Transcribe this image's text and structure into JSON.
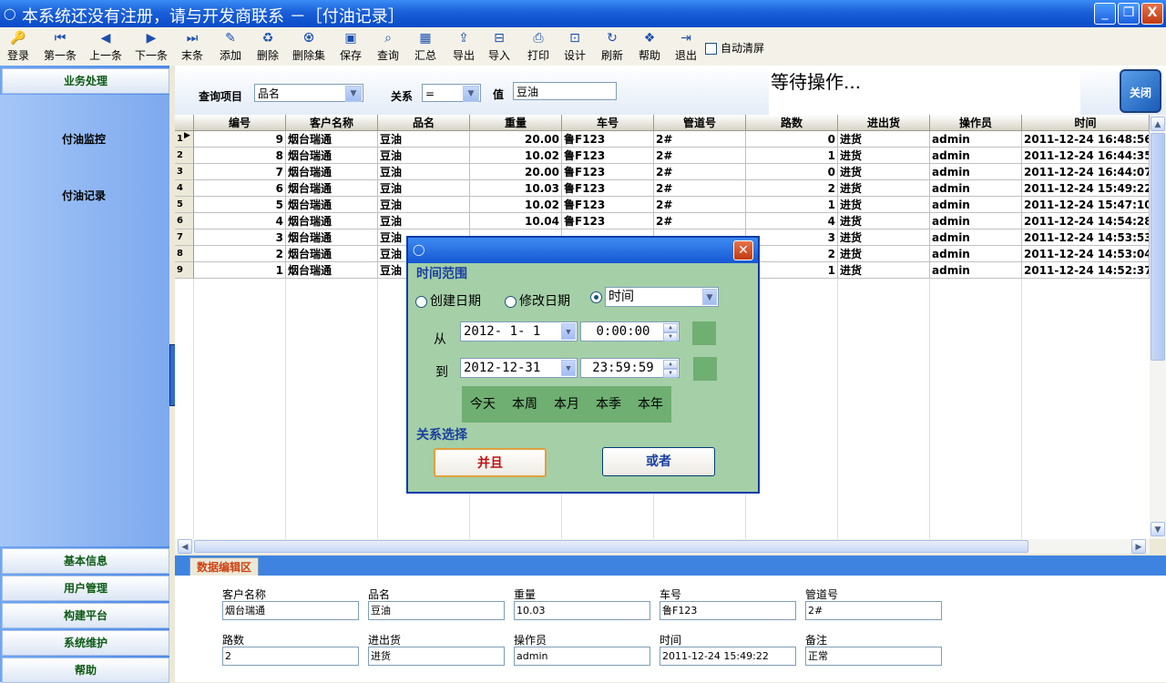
{
  "window": {
    "title": "本系统还没有注册，请与开发商联系 －［付油记录］",
    "minimize": "_",
    "restore": "❐",
    "close": "X"
  },
  "toolbar": {
    "items": [
      {
        "label": "登录",
        "icon": "key-icon"
      },
      {
        "label": "第一条",
        "icon": "first-icon"
      },
      {
        "label": "上一条",
        "icon": "prev-icon"
      },
      {
        "label": "下一条",
        "icon": "next-icon"
      },
      {
        "label": "末条",
        "icon": "last-icon"
      },
      {
        "label": "添加",
        "icon": "pen-icon"
      },
      {
        "label": "删除",
        "icon": "delete-icon"
      },
      {
        "label": "删除集",
        "icon": "delete-set-icon"
      },
      {
        "label": "保存",
        "icon": "save-icon"
      },
      {
        "label": "查询",
        "icon": "search-icon"
      },
      {
        "label": "汇总",
        "icon": "summary-icon"
      },
      {
        "label": "导出",
        "icon": "export-icon"
      },
      {
        "label": "导入",
        "icon": "import-icon"
      },
      {
        "label": "打印",
        "icon": "print-icon"
      },
      {
        "label": "设计",
        "icon": "design-icon"
      },
      {
        "label": "刷新",
        "icon": "refresh-icon"
      },
      {
        "label": "帮助",
        "icon": "help-icon"
      },
      {
        "label": "退出",
        "icon": "exit-icon"
      }
    ],
    "auto_clear": "自动清屏"
  },
  "nav": {
    "top": "业务处理",
    "items": [
      "付油监控",
      "付油记录"
    ],
    "bottom": [
      "基本信息",
      "用户管理",
      "构建平台",
      "系统维护",
      "帮助"
    ]
  },
  "query": {
    "item_label": "查询项目",
    "item_value": "品名",
    "relation_label": "关系",
    "relation_value": "=",
    "value_label": "值",
    "value_value": "豆油",
    "status": "等待操作...",
    "close_label": "关闭"
  },
  "grid": {
    "columns": [
      "编号",
      "客户名称",
      "品名",
      "重量",
      "车号",
      "管道号",
      "路数",
      "进出货",
      "操作员",
      "时间"
    ],
    "rows": [
      {
        "n": "1",
        "id": "9",
        "customer": "烟台瑞通",
        "product": "豆油",
        "weight": "20.00",
        "car": "鲁F123",
        "pipe": "2#",
        "lanes": "0",
        "io": "进货",
        "op": "admin",
        "time": "2011-12-24 16:48:56"
      },
      {
        "n": "2",
        "id": "8",
        "customer": "烟台瑞通",
        "product": "豆油",
        "weight": "10.02",
        "car": "鲁F123",
        "pipe": "2#",
        "lanes": "1",
        "io": "进货",
        "op": "admin",
        "time": "2011-12-24 16:44:35"
      },
      {
        "n": "3",
        "id": "7",
        "customer": "烟台瑞通",
        "product": "豆油",
        "weight": "20.00",
        "car": "鲁F123",
        "pipe": "2#",
        "lanes": "0",
        "io": "进货",
        "op": "admin",
        "time": "2011-12-24 16:44:07"
      },
      {
        "n": "4",
        "id": "6",
        "customer": "烟台瑞通",
        "product": "豆油",
        "weight": "10.03",
        "car": "鲁F123",
        "pipe": "2#",
        "lanes": "2",
        "io": "进货",
        "op": "admin",
        "time": "2011-12-24 15:49:22"
      },
      {
        "n": "5",
        "id": "5",
        "customer": "烟台瑞通",
        "product": "豆油",
        "weight": "10.02",
        "car": "鲁F123",
        "pipe": "2#",
        "lanes": "1",
        "io": "进货",
        "op": "admin",
        "time": "2011-12-24 15:47:10"
      },
      {
        "n": "6",
        "id": "4",
        "customer": "烟台瑞通",
        "product": "豆油",
        "weight": "10.04",
        "car": "鲁F123",
        "pipe": "2#",
        "lanes": "4",
        "io": "进货",
        "op": "admin",
        "time": "2011-12-24 14:54:28"
      },
      {
        "n": "7",
        "id": "3",
        "customer": "烟台瑞通",
        "product": "豆油",
        "weight": "",
        "car": "",
        "pipe": "",
        "lanes": "3",
        "io": "进货",
        "op": "admin",
        "time": "2011-12-24 14:53:53"
      },
      {
        "n": "8",
        "id": "2",
        "customer": "烟台瑞通",
        "product": "豆油",
        "weight": "",
        "car": "",
        "pipe": "",
        "lanes": "2",
        "io": "进货",
        "op": "admin",
        "time": "2011-12-24 14:53:04"
      },
      {
        "n": "9",
        "id": "1",
        "customer": "烟台瑞通",
        "product": "豆油",
        "weight": "",
        "car": "",
        "pipe": "",
        "lanes": "1",
        "io": "进货",
        "op": "admin",
        "time": "2011-12-24 14:52:37"
      }
    ]
  },
  "edit": {
    "tab": "数据编辑区",
    "fields": [
      {
        "label": "客户名称",
        "value": "烟台瑞通"
      },
      {
        "label": "品名",
        "value": "豆油"
      },
      {
        "label": "重量",
        "value": "10.03"
      },
      {
        "label": "车号",
        "value": "鲁F123"
      },
      {
        "label": "管道号",
        "value": "2#"
      },
      {
        "label": "路数",
        "value": "2"
      },
      {
        "label": "进出货",
        "value": "进货"
      },
      {
        "label": "操作员",
        "value": "admin"
      },
      {
        "label": "时间",
        "value": "2011-12-24 15:49:22"
      },
      {
        "label": "备注",
        "value": "正常"
      }
    ]
  },
  "dialog": {
    "section_time": "时间范围",
    "radio_create": "创建日期",
    "radio_modify": "修改日期",
    "time_field": "时间",
    "from_label": "从",
    "from_date": "2012- 1- 1",
    "from_time": "0:00:00",
    "to_label": "到",
    "to_date": "2012-12-31",
    "to_time": "23:59:59",
    "quick": [
      "今天",
      "本周",
      "本月",
      "本季",
      "本年"
    ],
    "section_relation": "关系选择",
    "and_label": "并且",
    "or_label": "或者"
  }
}
